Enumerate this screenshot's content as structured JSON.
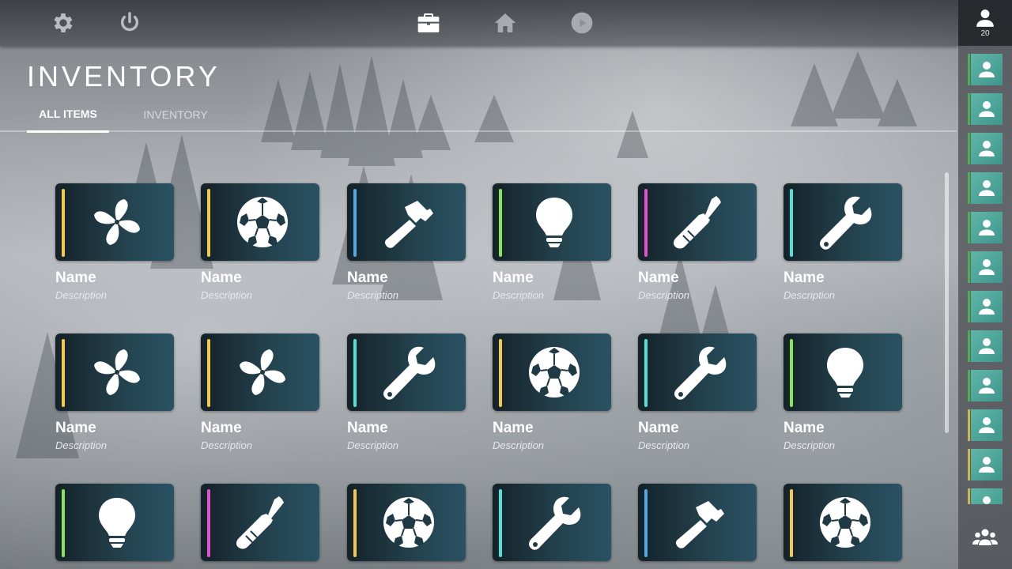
{
  "nav": {
    "icons": [
      "gear-icon",
      "power-icon",
      "briefcase-icon",
      "home-icon",
      "play-icon"
    ]
  },
  "profile": {
    "count": "20"
  },
  "page": {
    "title": "INVENTORY",
    "tabs": [
      {
        "label": "ALL ITEMS",
        "active": true
      },
      {
        "label": "INVENTORY",
        "active": false
      }
    ]
  },
  "colors": {
    "yellow": "#f2c94c",
    "blue": "#4fa8e6",
    "green": "#8be35a",
    "magenta": "#e64fcf",
    "cyan": "#4fe0d6",
    "friend_green": "#4caf50",
    "friend_yellow": "#c9b94a"
  },
  "items": [
    {
      "name": "Name",
      "description": "Description",
      "icon": "fan",
      "accent": "#f2c94c"
    },
    {
      "name": "Name",
      "description": "Description",
      "icon": "soccer-ball",
      "accent": "#f2c94c"
    },
    {
      "name": "Name",
      "description": "Description",
      "icon": "hammer",
      "accent": "#4fa8e6"
    },
    {
      "name": "Name",
      "description": "Description",
      "icon": "lightbulb",
      "accent": "#8be35a"
    },
    {
      "name": "Name",
      "description": "Description",
      "icon": "screwdriver",
      "accent": "#e64fcf"
    },
    {
      "name": "Name",
      "description": "Description",
      "icon": "wrench",
      "accent": "#4fe0d6"
    },
    {
      "name": "Name",
      "description": "Description",
      "icon": "fan",
      "accent": "#f2c94c"
    },
    {
      "name": "Name",
      "description": "Description",
      "icon": "fan",
      "accent": "#f2c94c"
    },
    {
      "name": "Name",
      "description": "Description",
      "icon": "wrench",
      "accent": "#4fe0d6"
    },
    {
      "name": "Name",
      "description": "Description",
      "icon": "soccer-ball",
      "accent": "#f2c94c"
    },
    {
      "name": "Name",
      "description": "Description",
      "icon": "wrench",
      "accent": "#4fe0d6"
    },
    {
      "name": "Name",
      "description": "Description",
      "icon": "lightbulb",
      "accent": "#8be35a"
    },
    {
      "name": "",
      "description": "",
      "icon": "lightbulb",
      "accent": "#8be35a"
    },
    {
      "name": "",
      "description": "",
      "icon": "screwdriver",
      "accent": "#e64fcf"
    },
    {
      "name": "",
      "description": "",
      "icon": "soccer-ball",
      "accent": "#f2c94c"
    },
    {
      "name": "",
      "description": "",
      "icon": "wrench",
      "accent": "#4fe0d6"
    },
    {
      "name": "",
      "description": "",
      "icon": "hammer",
      "accent": "#4fa8e6"
    },
    {
      "name": "",
      "description": "",
      "icon": "soccer-ball",
      "accent": "#f2c94c"
    }
  ],
  "friends": [
    {
      "accent": "#4caf50"
    },
    {
      "accent": "#4caf50"
    },
    {
      "accent": "#4caf50"
    },
    {
      "accent": "#4caf50"
    },
    {
      "accent": "#4caf50"
    },
    {
      "accent": "#4caf50"
    },
    {
      "accent": "#4caf50"
    },
    {
      "accent": "#4caf50"
    },
    {
      "accent": "#4caf50"
    },
    {
      "accent": "#c9b94a"
    },
    {
      "accent": "#c9b94a"
    },
    {
      "accent": "#c9b94a"
    }
  ]
}
